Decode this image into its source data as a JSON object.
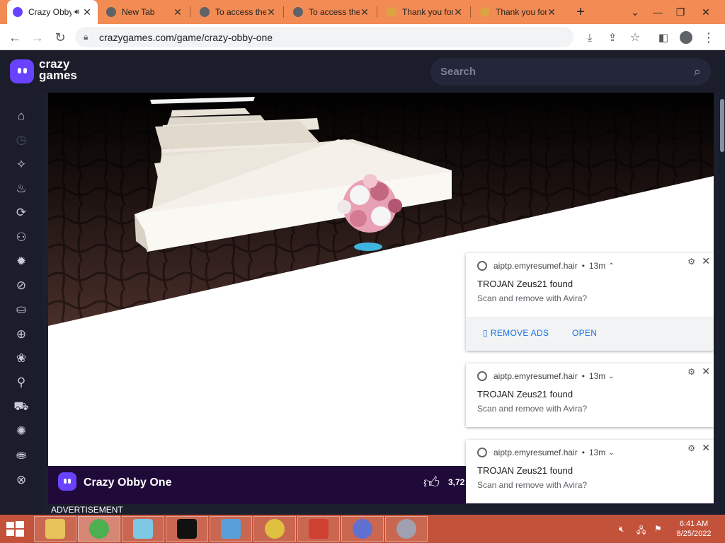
{
  "browser": {
    "tabs": [
      {
        "title": "Crazy Obby One",
        "favicon_color": "#6842ff",
        "active": true
      },
      {
        "title": "New Tab",
        "favicon_color": "#5f6368",
        "active": false
      },
      {
        "title": "To access the",
        "favicon_color": "#5f6368",
        "active": false
      },
      {
        "title": "To access the",
        "favicon_color": "#5f6368",
        "active": false
      },
      {
        "title": "Thank you for",
        "favicon_color": "#d9a441",
        "active": false
      },
      {
        "title": "Thank you for",
        "favicon_color": "#d9a441",
        "active": false
      }
    ],
    "new_tab_label": "+",
    "url": "crazygames.com/game/crazy-obby-one"
  },
  "site": {
    "logo_line1": "crazy",
    "logo_line2": "games",
    "search_placeholder": "Search",
    "accent_color": "#6842ff",
    "sidebar_icons": [
      "home-icon",
      "recent-icon",
      "new-icon",
      "trending-icon",
      "updated-icon",
      "multiplayer-icon",
      "action-icon",
      "adventure-icon",
      "casual-icon",
      "sports-icon",
      "beauty-icon",
      "bike-icon",
      "car-icon",
      "clicker-icon",
      "io-icon",
      "driving-icon"
    ]
  },
  "game": {
    "title": "Crazy Obby One",
    "like_count": "3,72",
    "advertisement_label": "ADVERTISEMENT"
  },
  "notifications": [
    {
      "source": "aiptp.emyresumef.hair",
      "time": "13m",
      "title": "TROJAN Zeus21 found",
      "message": "Scan and remove with Avira?",
      "expanded": true,
      "action1": "REMOVE ADS",
      "action2": "OPEN"
    },
    {
      "source": "aiptp.emyresumef.hair",
      "time": "13m",
      "title": "TROJAN Zeus21 found",
      "message": "Scan and remove with Avira?",
      "expanded": false
    },
    {
      "source": "aiptp.emyresumef.hair",
      "time": "13m",
      "title": "TROJAN Zeus21 found",
      "message": "Scan and remove with Avira?",
      "expanded": false
    }
  ],
  "taskbar": {
    "time": "6:41 AM",
    "date": "8/25/2022",
    "apps": [
      {
        "name": "file-explorer-icon",
        "color": "#e8c25a"
      },
      {
        "name": "chrome-icon",
        "color": "#4caf50"
      },
      {
        "name": "notes-icon",
        "color": "#7ec8e3"
      },
      {
        "name": "7zip-icon",
        "color": "#111111"
      },
      {
        "name": "control-panel-icon",
        "color": "#5aa0d8"
      },
      {
        "name": "disc-icon",
        "color": "#e0c040"
      },
      {
        "name": "windows-flag-icon",
        "color": "#d04030"
      },
      {
        "name": "media-player-icon",
        "color": "#6070d0"
      },
      {
        "name": "dvd-icon",
        "color": "#a0a0b0"
      }
    ]
  }
}
